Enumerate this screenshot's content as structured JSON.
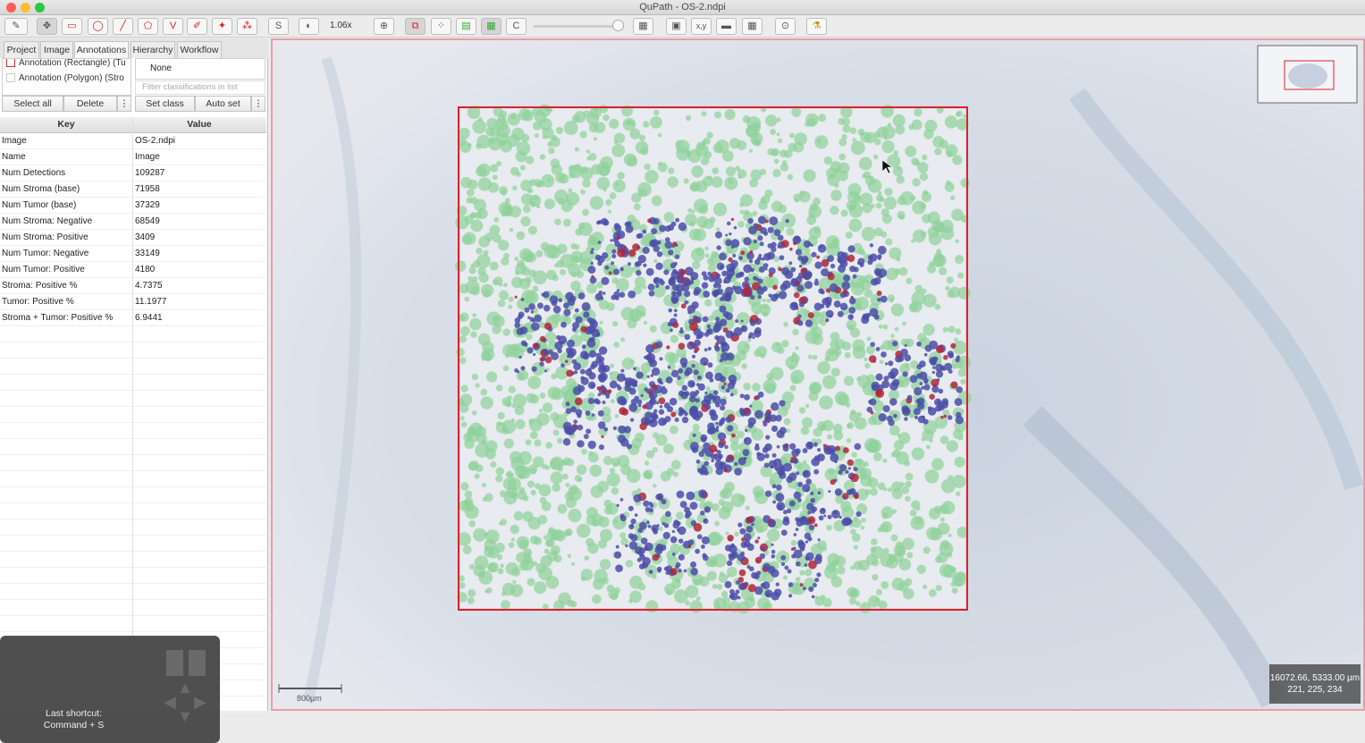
{
  "window": {
    "title": "QuPath - OS-2.ndpi"
  },
  "toolbar": {
    "zoom_label": "1.06x",
    "text_tool_labels": [
      "S",
      "V",
      "C",
      "x,y"
    ]
  },
  "tabs": [
    {
      "label": "Project"
    },
    {
      "label": "Image"
    },
    {
      "label": "Annotations"
    },
    {
      "label": "Hierarchy"
    },
    {
      "label": "Workflow"
    }
  ],
  "annotations": {
    "items": [
      "Annotation (Rectangle) (Tu",
      "Annotation (Polygon) (Stro"
    ],
    "class_selected": "None",
    "filter_placeholder": "Filter classifications in list",
    "buttons": {
      "select_all": "Select all",
      "delete": "Delete",
      "more": "⋮",
      "set_class": "Set class",
      "auto_set": "Auto set"
    }
  },
  "table": {
    "headers": {
      "key": "Key",
      "value": "Value"
    },
    "rows": [
      {
        "key": "Image",
        "value": "OS-2.ndpi"
      },
      {
        "key": "Name",
        "value": "Image"
      },
      {
        "key": "Num Detections",
        "value": "109287"
      },
      {
        "key": "Num Stroma (base)",
        "value": "71958"
      },
      {
        "key": "Num Tumor (base)",
        "value": "37329"
      },
      {
        "key": "Num Stroma: Negative",
        "value": "68549"
      },
      {
        "key": "Num Stroma: Positive",
        "value": "3409"
      },
      {
        "key": "Num Tumor: Negative",
        "value": "33149"
      },
      {
        "key": "Num Tumor: Positive",
        "value": "4180"
      },
      {
        "key": "Stroma: Positive %",
        "value": "4.7375"
      },
      {
        "key": "Tumor: Positive %",
        "value": "11.1977"
      },
      {
        "key": "Stroma + Tumor: Positive %",
        "value": "6.9441"
      }
    ]
  },
  "hud": {
    "line1": "Last shortcut:",
    "line2": "Command + S"
  },
  "viewer": {
    "scale_bar": "800µm",
    "cursor_coords": "16072.66, 5333.00 µm",
    "pixel_rgb": "221, 225, 234"
  },
  "colors": {
    "annotation": "#e0202a",
    "stroma": "#8fd19a",
    "tumor": "#4b4ea8",
    "positive": "#b0273a"
  }
}
